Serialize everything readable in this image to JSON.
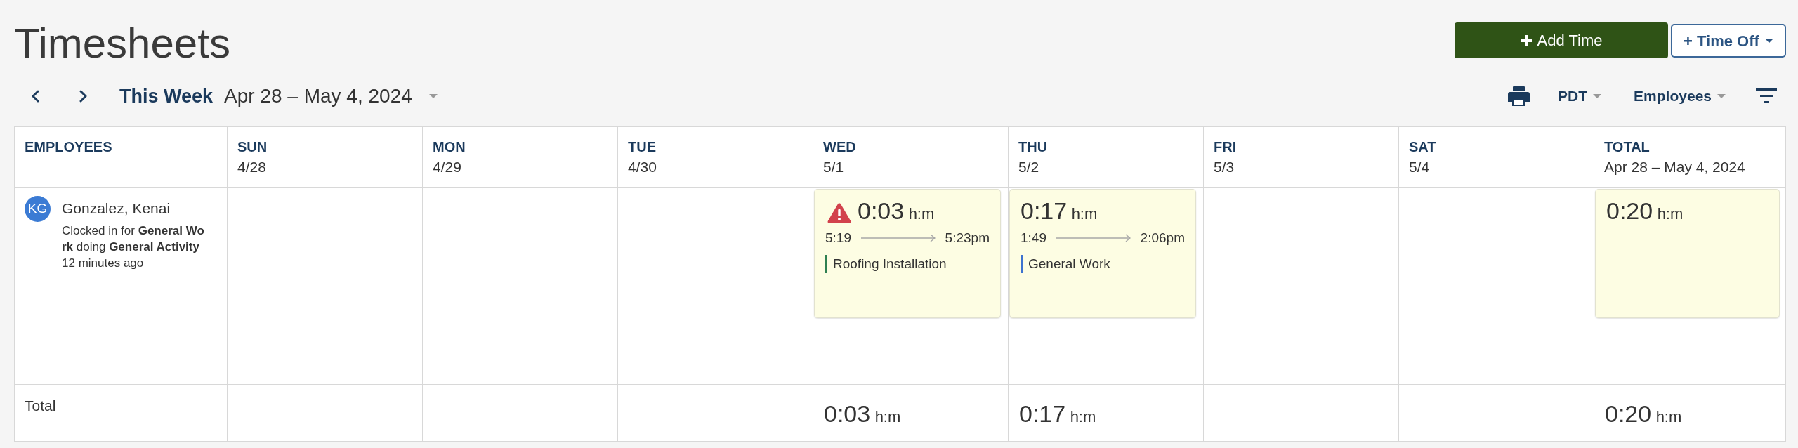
{
  "page": {
    "title": "Timesheets"
  },
  "actions": [
    {
      "kind": "primary",
      "label": "Add Time"
    },
    {
      "kind": "dropdown",
      "label": "+ Time Off"
    }
  ],
  "week_nav": {
    "label": "This Week",
    "range": "Apr 28 – May 4, 2024"
  },
  "toolbar": {
    "dropdowns": [
      {
        "label": "PDT"
      },
      {
        "label": "Employees"
      }
    ]
  },
  "timesheet": {
    "employee_column": {
      "title": "EMPLOYEES"
    },
    "days": [
      {
        "title": "SUN",
        "date": "4/28"
      },
      {
        "title": "MON",
        "date": "4/29"
      },
      {
        "title": "TUE",
        "date": "4/30"
      },
      {
        "title": "WED",
        "date": "5/1",
        "entry": {
          "duration": "0:03",
          "unit": "h:m",
          "warning": true,
          "start": "5:19",
          "end": "5:23pm",
          "job": "Roofing Installation",
          "color": "#2f8051"
        },
        "day_total": {
          "duration": "0:03",
          "unit": "h:m"
        }
      },
      {
        "title": "THU",
        "date": "5/2",
        "entry": {
          "duration": "0:17",
          "unit": "h:m",
          "warning": false,
          "start": "1:49",
          "end": "2:06pm",
          "job": "General Work",
          "color": "#3d72cf"
        },
        "day_total": {
          "duration": "0:17",
          "unit": "h:m"
        }
      },
      {
        "title": "FRI",
        "date": "5/3"
      },
      {
        "title": "SAT",
        "date": "5/4"
      }
    ],
    "total_column": {
      "title": "TOTAL",
      "date": "Apr 28 – May 4, 2024",
      "entry": {
        "duration": "0:20",
        "unit": "h:m"
      },
      "grand_total": {
        "duration": "0:20",
        "unit": "h:m"
      }
    },
    "employee": {
      "initials": "KG",
      "name": "Gonzalez, Kenai",
      "status": "Clocked in for **General Work** doing **General Activity**",
      "since": "12 minutes ago"
    },
    "totals_label": "Total"
  }
}
